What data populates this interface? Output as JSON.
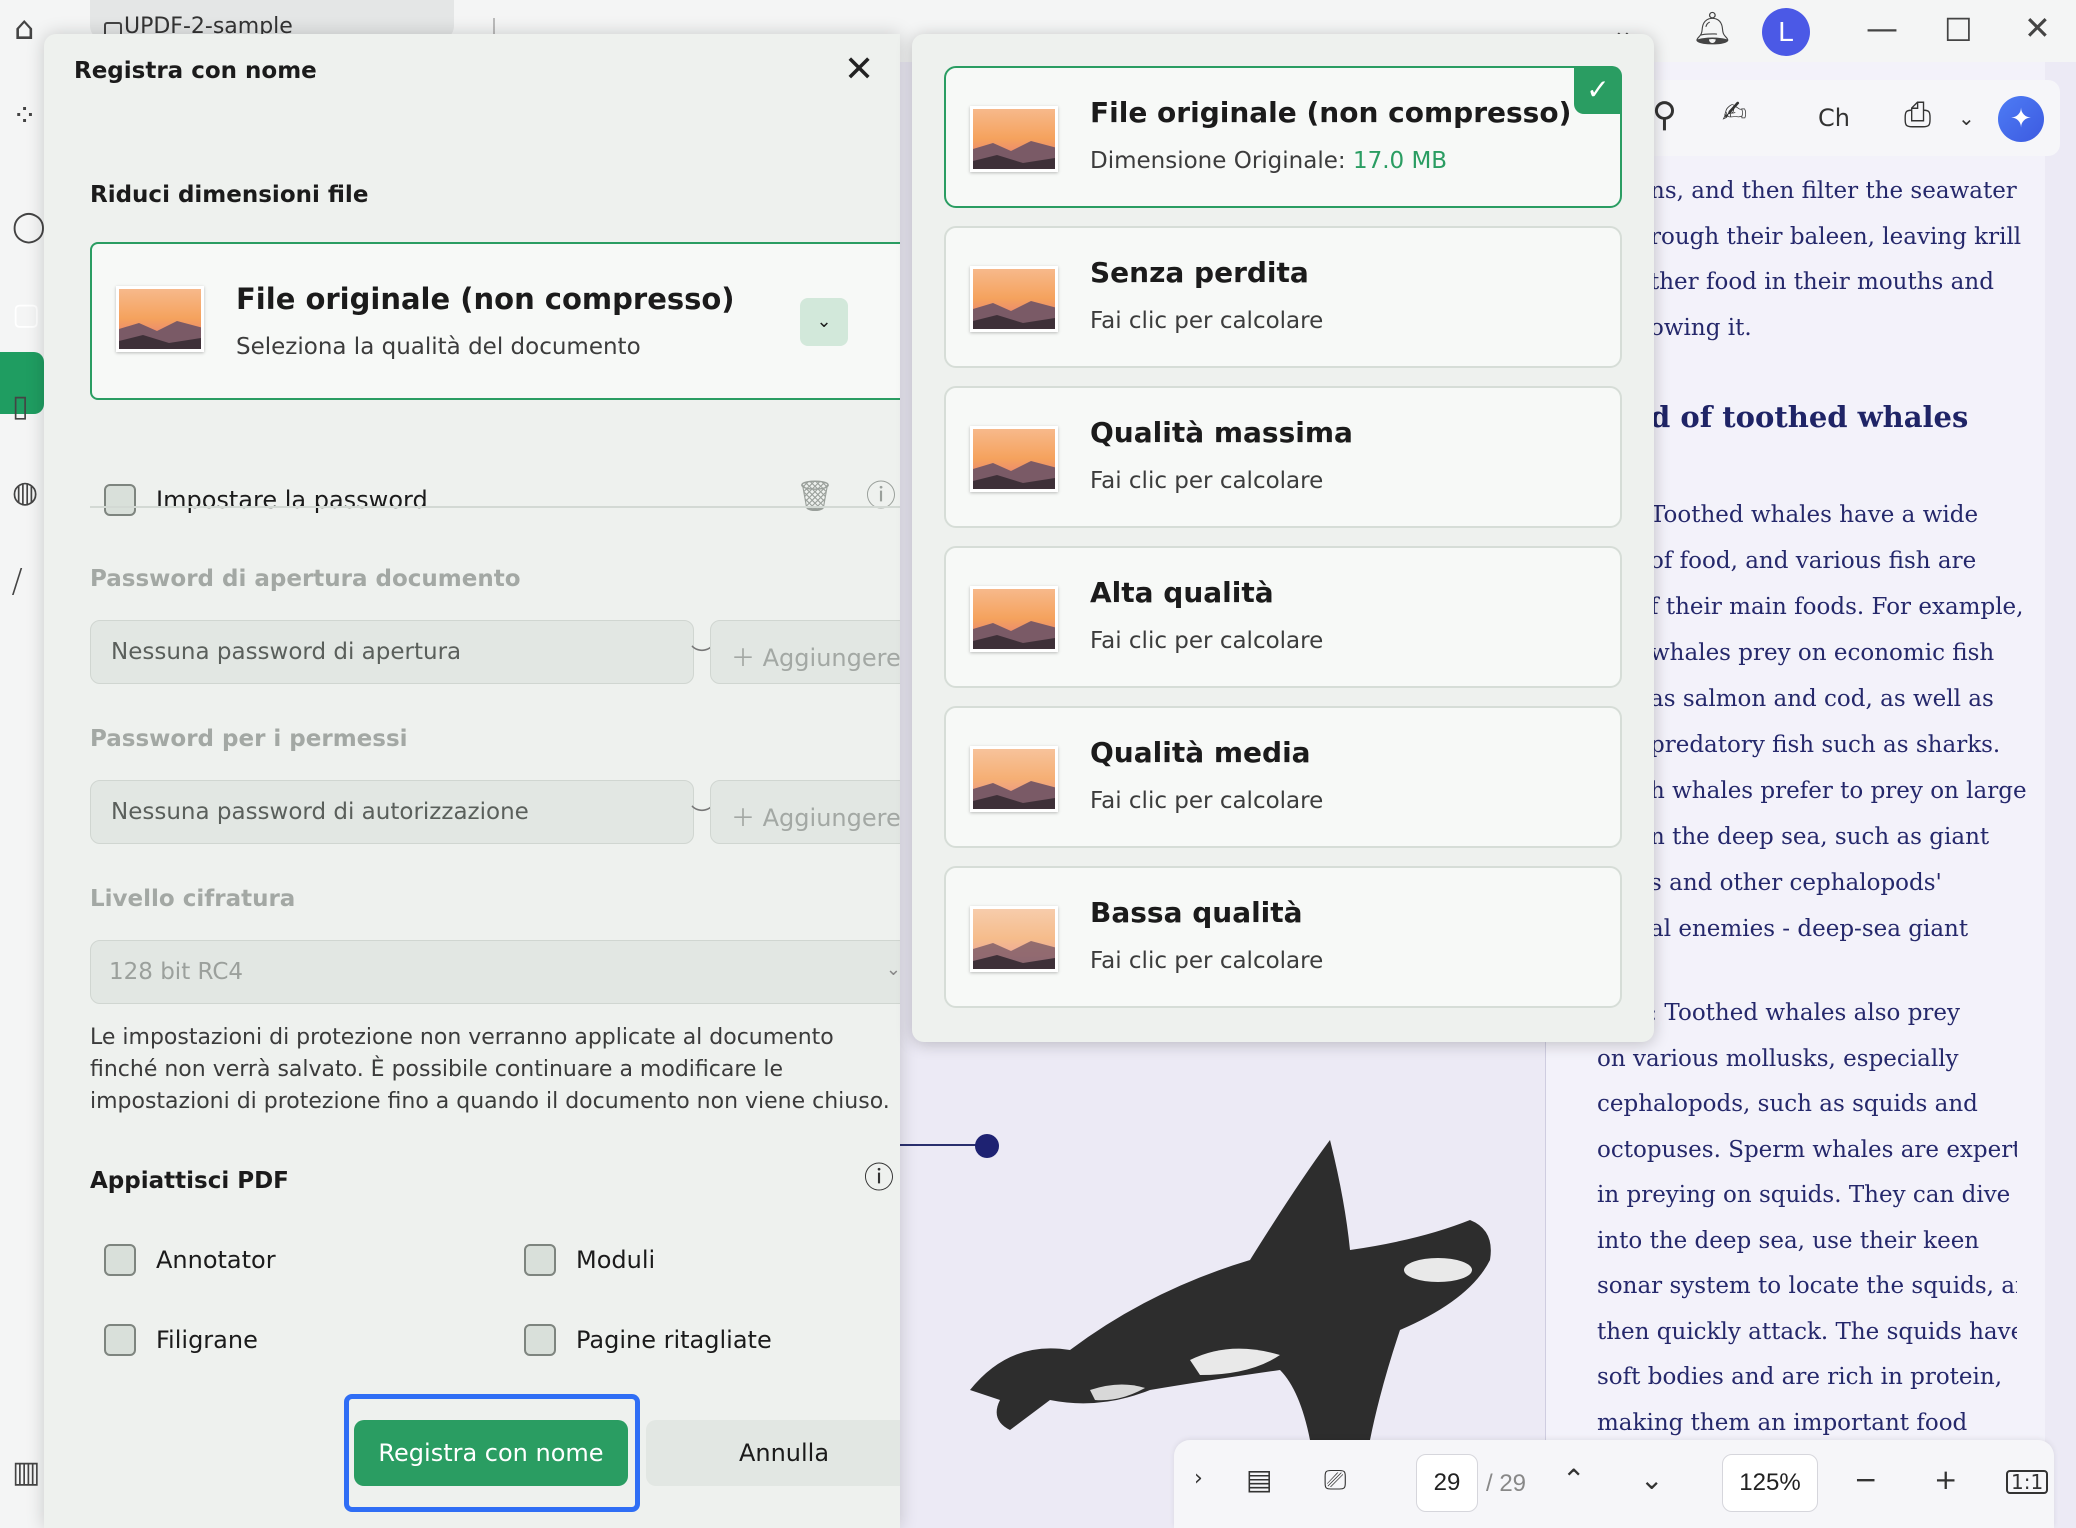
{
  "topbar": {
    "tab_label": "UPDF-2-sample",
    "avatar_initial": "L"
  },
  "document": {
    "heading": "d of toothed whales",
    "lines_top": [
      "ns, and then filter the seawater",
      "rough their baleen, leaving krill",
      "ther food in their mouths and",
      "owing it."
    ],
    "lines_mid": [
      "Toothed whales have a wide",
      "of food, and various fish are",
      "f their main foods. For example,",
      "whales prey on economic fish",
      "as salmon and cod, as well as",
      "predatory fish such as sharks.",
      "h whales prefer to prey on large",
      "n the deep sea, such as giant",
      "s and other cephalopods'",
      "al enemies - deep-sea giant"
    ],
    "lines_bottom": [
      "usks: Toothed whales also prey",
      "on various mollusks, especially",
      "cephalopods, such as squids and",
      "octopuses. Sperm whales are experts",
      "in preying on squids. They can dive",
      "into the deep sea, use their keen",
      "sonar system to locate the squids, and",
      "then quickly attack. The squids have",
      "soft bodies and are rich in protein,",
      "making them an important food"
    ],
    "toolbar_partial_label": "Ch"
  },
  "bottom_nav": {
    "current_page": "29",
    "total_pages": "/ 29",
    "zoom": "125%"
  },
  "dialog": {
    "title": "Registra con nome",
    "reduce_section": "Riduci dimensioni file",
    "selected_quality_title": "File originale (non compresso)",
    "selected_quality_sub": "Seleziona la qualità del documento",
    "set_password_label": "Impostare la password",
    "open_password_section": "Password di apertura documento",
    "open_password_value": "Nessuna password di apertura",
    "add_label": "Aggiungere",
    "permissions_section": "Password per i permessi",
    "permissions_value": "Nessuna password di autorizzazione",
    "encryption_section": "Livello cifratura",
    "encryption_value": "128 bit RC4",
    "note": "Le impostazioni di protezione non verranno applicate al documento finché non verrà salvato. È possibile continuare a modificare le impostazioni di protezione fino a quando il documento non viene chiuso.",
    "flatten_section": "Appiattisci PDF",
    "flatten_options": [
      "Annotator",
      "Moduli",
      "Filigrane",
      "Pagine ritagliate"
    ],
    "save_button": "Registra con nome",
    "cancel_button": "Annulla"
  },
  "quality_options": [
    {
      "title": "File originale (non compresso)",
      "sub_prefix": "Dimensione Originale: ",
      "size": "17.0 MB",
      "selected": true
    },
    {
      "title": "Senza perdita",
      "sub": "Fai clic per calcolare"
    },
    {
      "title": "Qualità massima",
      "sub": "Fai clic per calcolare"
    },
    {
      "title": "Alta qualità",
      "sub": "Fai clic per calcolare"
    },
    {
      "title": "Qualità media",
      "sub": "Fai clic per calcolare"
    },
    {
      "title": "Bassa qualità",
      "sub": "Fai clic per calcolare"
    }
  ],
  "colors": {
    "accent": "#2a9d62",
    "focus_outline": "#2f6ef5",
    "doc_text": "#25286b"
  }
}
